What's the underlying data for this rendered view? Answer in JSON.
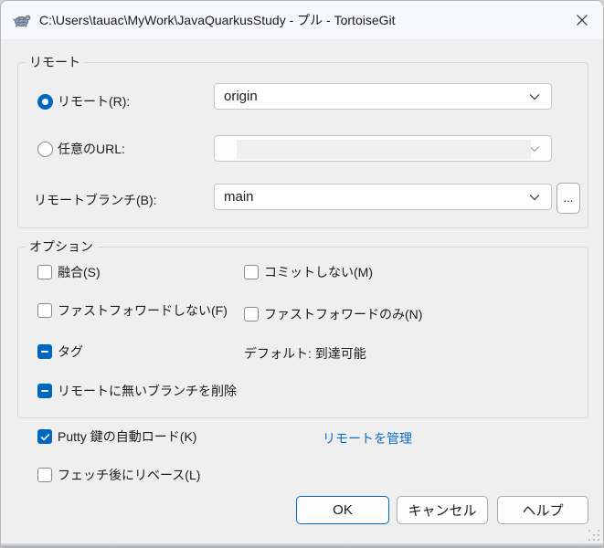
{
  "window": {
    "title": "C:\\Users\\tauac\\MyWork\\JavaQuarkusStudy - プル - TortoiseGit"
  },
  "remote_group": {
    "label": "リモート",
    "remote_radio_label": "リモート(R):",
    "remote_value": "origin",
    "url_radio_label": "任意のURL:",
    "url_value": "",
    "branch_label": "リモートブランチ(B):",
    "branch_value": "main",
    "browse_label": "..."
  },
  "options_group": {
    "label": "オプション",
    "squash_label": "融合(S)",
    "no_commit_label": "コミットしない(M)",
    "no_ff_label": "ファストフォワードしない(F)",
    "ff_only_label": "ファストフォワードのみ(N)",
    "tags_label": "タグ",
    "tags_default_text": "デフォルト: 到達可能",
    "prune_label": "リモートに無いブランチを削除"
  },
  "bottom": {
    "putty_label": "Putty 鍵の自動ロード(K)",
    "rebase_label": "フェッチ後にリベース(L)",
    "manage_remotes_link": "リモートを管理"
  },
  "buttons": {
    "ok": "OK",
    "cancel": "キャンセル",
    "help": "ヘルプ"
  },
  "states": {
    "remote_radio": "selected",
    "url_radio": "unselected",
    "squash": "unchecked",
    "no_commit": "unchecked",
    "no_ff": "unchecked",
    "ff_only": "unchecked",
    "tags": "indeterminate",
    "prune": "indeterminate",
    "putty": "checked",
    "rebase": "unchecked"
  },
  "colors": {
    "accent": "#0067c0",
    "link": "#0b6bcb",
    "dialog_background": "#efefef",
    "titlebar_background": "#f7f8fb"
  }
}
